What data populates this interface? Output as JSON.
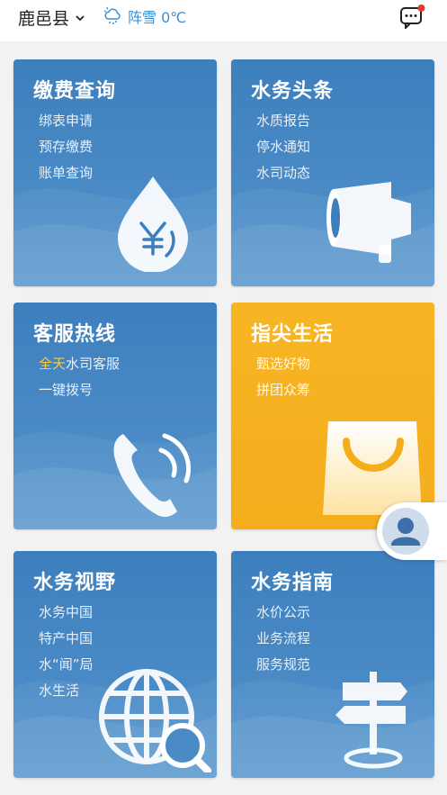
{
  "header": {
    "location": "鹿邑县",
    "weather_text": "阵雪 0℃"
  },
  "cards": [
    {
      "title": "缴费查询",
      "items": [
        "绑表申请",
        "预存缴费",
        "账单查询"
      ]
    },
    {
      "title": "水务头条",
      "items": [
        "水质报告",
        "停水通知",
        "水司动态"
      ]
    },
    {
      "title": "客服热线",
      "items_hl": {
        "highlight": "全天",
        "rest": "水司客服"
      },
      "items": [
        "一键拨号"
      ]
    },
    {
      "title": "指尖生活",
      "items": [
        "甄选好物",
        "拼团众筹"
      ]
    },
    {
      "title": "水务视野",
      "items": [
        "水务中国",
        "特产中国",
        "水“闻”局",
        "水生活"
      ]
    },
    {
      "title": "水务指南",
      "items": [
        "水价公示",
        "业务流程",
        "服务规范"
      ]
    }
  ],
  "colors": {
    "card_blue": "#3d7fbd",
    "card_yellow": "#f7b524",
    "highlight": "#ffcc33",
    "weather": "#3a8fd6",
    "badge": "#e53935"
  },
  "icons": [
    "chevron-down-icon",
    "snow-cloud-icon",
    "message-icon",
    "yen-drop-icon",
    "megaphone-icon",
    "phone-icon",
    "shopping-bag-icon",
    "globe-search-icon",
    "signpost-icon",
    "user-icon"
  ]
}
